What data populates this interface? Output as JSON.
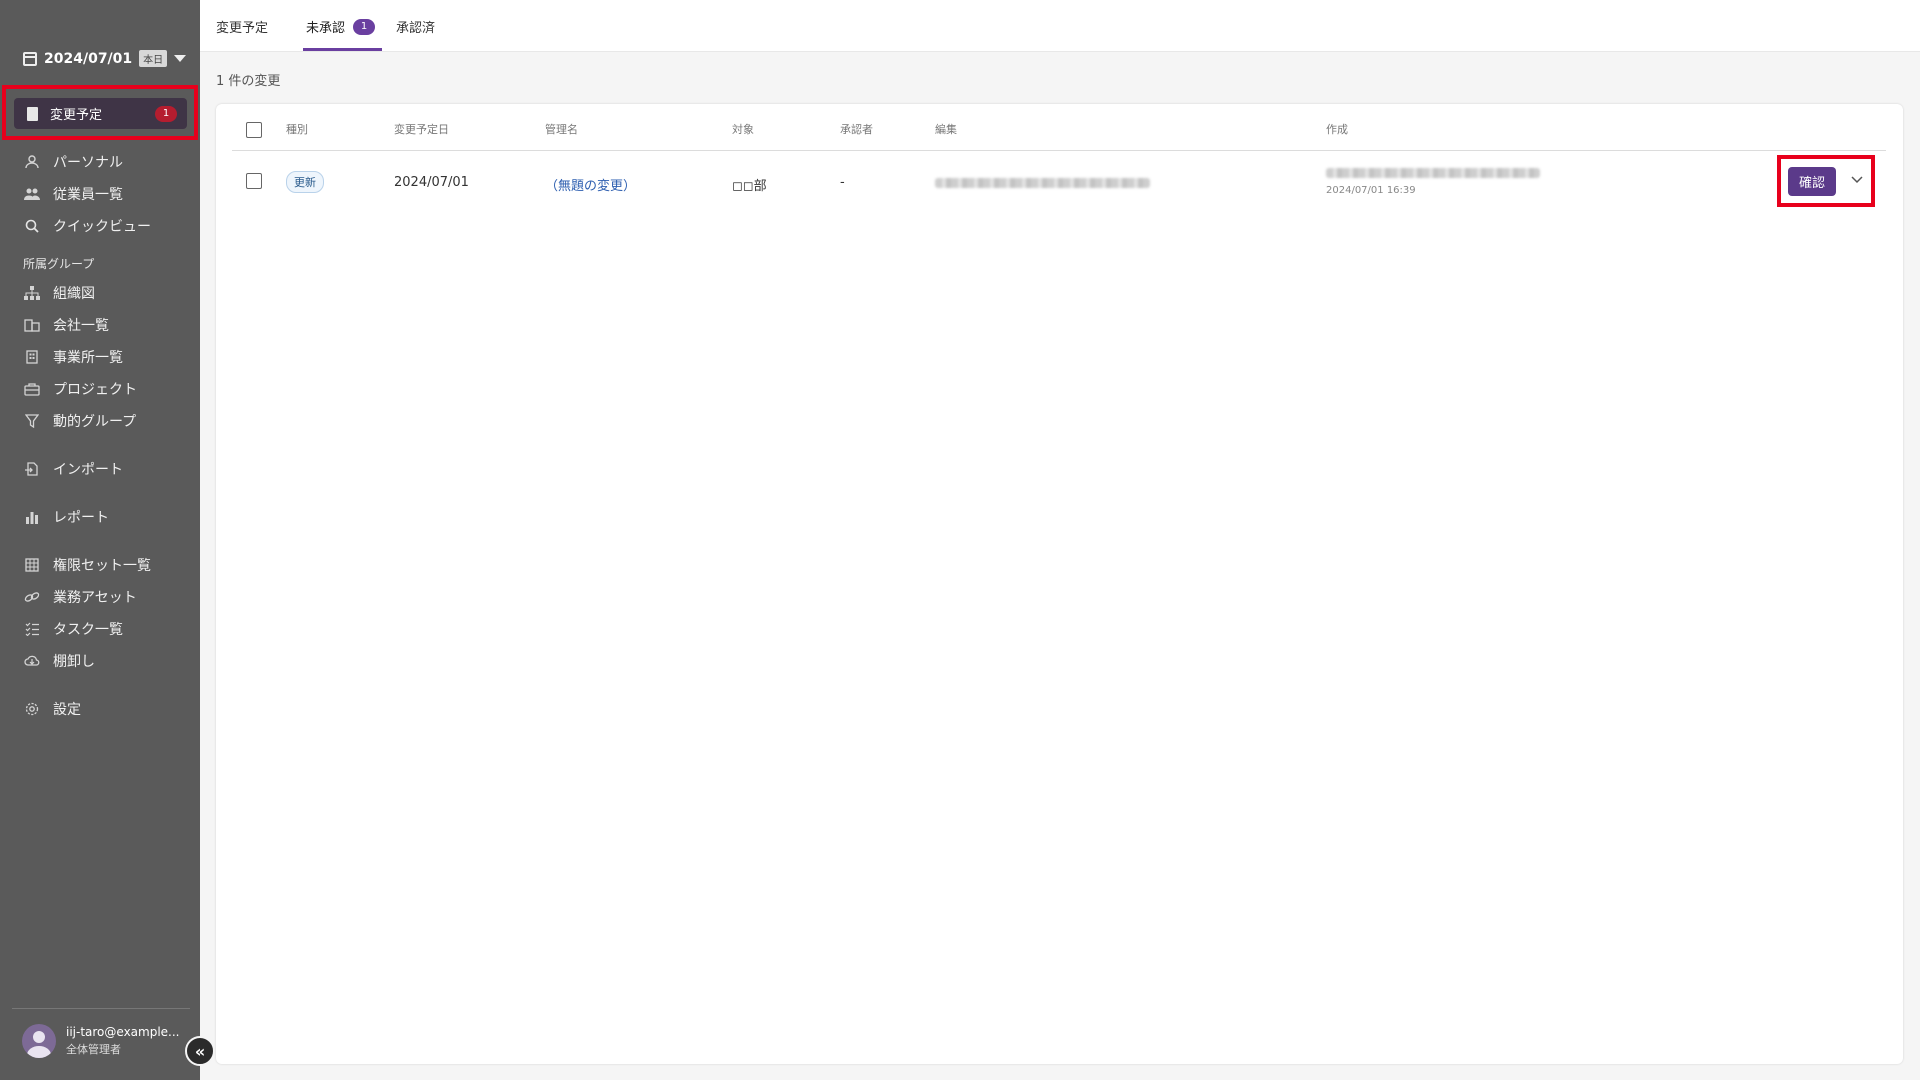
{
  "sidebar": {
    "date": "2024/07/01",
    "today_label": "本日",
    "active_item": {
      "label": "変更予定",
      "count": "1"
    },
    "items": [
      {
        "label": "パーソナル",
        "icon": "person-icon"
      },
      {
        "label": "従業員一覧",
        "icon": "people-icon"
      },
      {
        "label": "クイックビュー",
        "icon": "search-icon"
      }
    ],
    "group_section_label": "所属グループ",
    "group_items": [
      {
        "label": "組織図",
        "icon": "org-chart-icon"
      },
      {
        "label": "会社一覧",
        "icon": "building-icon"
      },
      {
        "label": "事業所一覧",
        "icon": "office-icon"
      },
      {
        "label": "プロジェクト",
        "icon": "briefcase-icon"
      },
      {
        "label": "動的グループ",
        "icon": "filter-icon"
      }
    ],
    "import_label": "インポート",
    "report_label": "レポート",
    "admin_items": [
      {
        "label": "権限セット一覧",
        "icon": "grid-icon"
      },
      {
        "label": "業務アセット",
        "icon": "link-icon"
      },
      {
        "label": "タスク一覧",
        "icon": "checklist-icon"
      },
      {
        "label": "棚卸し",
        "icon": "cloud-download-icon"
      }
    ],
    "settings_label": "設定",
    "user": {
      "email": "iij-taro@example...",
      "role": "全体管理者"
    }
  },
  "tabs": [
    {
      "label": "変更予定"
    },
    {
      "label": "未承認",
      "count": "1"
    },
    {
      "label": "承認済"
    }
  ],
  "change_count_text": "1 件の変更",
  "table": {
    "headers": {
      "type": "種別",
      "scheduled_date": "変更予定日",
      "admin_name": "管理名",
      "target": "対象",
      "approver": "承認者",
      "edit": "編集",
      "created": "作成"
    },
    "rows": [
      {
        "type": "更新",
        "scheduled_date": "2024/07/01",
        "admin_name": "（無題の変更）",
        "target": "◻◻部",
        "approver": "-",
        "created_time": "2024/07/01 16:39",
        "action_label": "確認"
      }
    ]
  }
}
